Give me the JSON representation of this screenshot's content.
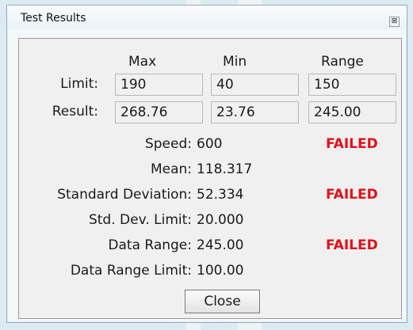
{
  "window": {
    "title": "Test Results",
    "close_glyph": "⊠"
  },
  "columns": {
    "max": "Max",
    "min": "Min",
    "range": "Range"
  },
  "rows": {
    "limit": {
      "label": "Limit:",
      "max": "190",
      "min": "40",
      "range": "150"
    },
    "result": {
      "label": "Result:",
      "max": "268.76",
      "min": "23.76",
      "range": "245.00"
    }
  },
  "stats": [
    {
      "label": "Speed:",
      "value": "600",
      "status": "FAILED"
    },
    {
      "label": "Mean:",
      "value": "118.317",
      "status": ""
    },
    {
      "label": "Standard Deviation:",
      "value": "52.334",
      "status": "FAILED"
    },
    {
      "label": "Std. Dev. Limit:",
      "value": "20.000",
      "status": ""
    },
    {
      "label": "Data Range:",
      "value": "245.00",
      "status": "FAILED"
    },
    {
      "label": "Data Range Limit:",
      "value": "100.00",
      "status": ""
    }
  ],
  "buttons": {
    "close": "Close"
  },
  "colors": {
    "failed": "#e0111a",
    "background": "#dcebf1"
  }
}
